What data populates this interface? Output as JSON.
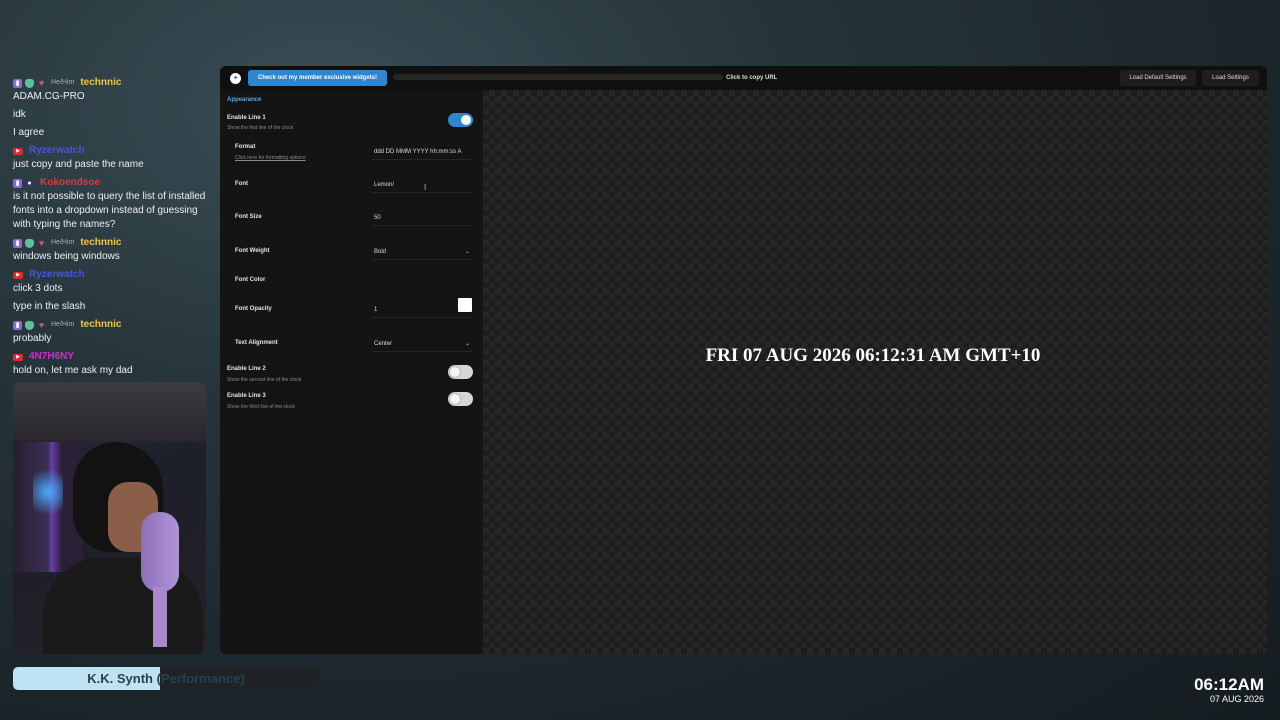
{
  "chat": {
    "messages": [
      {
        "badges": [
          "twitch-icon",
          "shield-icon",
          "heart-icon"
        ],
        "pronoun": "He/Him",
        "user": "technnic",
        "user_color": "#f2c541",
        "text": "ADAM.CG-PRO"
      },
      {
        "text": "idk"
      },
      {
        "text": "I agree"
      },
      {
        "badges": [
          "youtube-icon"
        ],
        "user": "Ryzerwatch",
        "user_color": "#4a55d6",
        "text": "just copy and paste the name"
      },
      {
        "badges": [
          "twitch-icon",
          "member-icon"
        ],
        "user": "Kokoendsoe",
        "user_color": "#d43d3d",
        "text": "is it not possible to query the list of installed fonts into a dropdown instead of guessing with typing the names?"
      },
      {
        "badges": [
          "twitch-icon",
          "shield-icon",
          "heart-icon"
        ],
        "pronoun": "He/Him",
        "user": "technnic",
        "user_color": "#f2c541",
        "text": "windows being windows"
      },
      {
        "badges": [
          "youtube-icon"
        ],
        "user": "Ryzerwatch",
        "user_color": "#4a55d6",
        "text": "click 3 dots"
      },
      {
        "text": "type in the slash"
      },
      {
        "badges": [
          "twitch-icon",
          "shield-icon",
          "heart-icon"
        ],
        "pronoun": "He/Him",
        "user": "technnic",
        "user_color": "#f2c541",
        "text": "probably"
      },
      {
        "badges": [
          "youtube-icon"
        ],
        "user": "4N7H6NY",
        "user_color": "#cc2ecc",
        "text": "hold on, let me ask my dad"
      }
    ]
  },
  "now_playing": {
    "text": "K.K. Synth (Performance)",
    "progress": 0.48
  },
  "corner_clock": {
    "time": "06:12AM",
    "date": "07 AUG 2026"
  },
  "app": {
    "promo_button": "Check out my member exclusive widgets!",
    "copy_url": "Click to copy URL",
    "load_default": "Load Default Settings",
    "load_settings": "Load Settings",
    "settings": {
      "section": "Appearance",
      "enable_line1": {
        "label": "Enable Line 1",
        "desc": "Show the first line of the clock",
        "on": true
      },
      "format": {
        "label": "Format",
        "link": "Click here for formatting options",
        "value": "ddd DD MMM YYYY hh:mm:ss A"
      },
      "font": {
        "label": "Font",
        "value": "Lemon/"
      },
      "font_size": {
        "label": "Font Size",
        "value": "50"
      },
      "font_weight": {
        "label": "Font Weight",
        "value": "Bold"
      },
      "font_color": {
        "label": "Font Color",
        "value": "#ffffff"
      },
      "font_opacity": {
        "label": "Font Opacity",
        "value": "1"
      },
      "text_alignment": {
        "label": "Text Alignment",
        "value": "Center"
      },
      "enable_line2": {
        "label": "Enable Line 2",
        "desc": "Show the second line of the clock",
        "on": false
      },
      "enable_line3": {
        "label": "Enable Line 3",
        "desc": "Show the third line of the clock",
        "on": false
      }
    },
    "preview_text": "FRI 07 AUG 2026 06:12:31 AM GMT+10"
  }
}
